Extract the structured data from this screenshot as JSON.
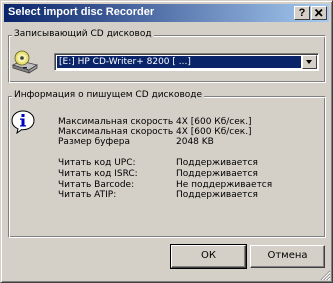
{
  "window": {
    "title": "Select import disc Recorder"
  },
  "titlebar_buttons": {
    "help": "?",
    "close": "X"
  },
  "recorder_group": {
    "label": "Записывающий CD дисковод",
    "selected_drive": "[E:] HP CD-Writer+ 8200 [ ...]"
  },
  "info_group": {
    "label": "Информация о пишущем CD дисководе",
    "properties": [
      {
        "label": "Максимальная скорость",
        "value": "4X [600 Кб/сек.]"
      },
      {
        "label": "Максимальная скорость",
        "value": "4X [600 Кб/сек.]"
      },
      {
        "label": "Размер буфера",
        "value": "2048 KB"
      },
      {
        "label": "Читать код UPC:",
        "value": "Поддерживается"
      },
      {
        "label": "Читать код ISRC:",
        "value": "Поддерживается"
      },
      {
        "label": "Читать Barcode:",
        "value": "Не поддерживается"
      },
      {
        "label": "Читать ATIP:",
        "value": "Поддерживается"
      }
    ]
  },
  "buttons": {
    "ok": "ОК",
    "cancel": "Отмена"
  },
  "colors": {
    "titlebar_start": "#0a246a",
    "titlebar_end": "#a6caf0",
    "face": "#d4d0c8",
    "selection": "#0a246a"
  }
}
